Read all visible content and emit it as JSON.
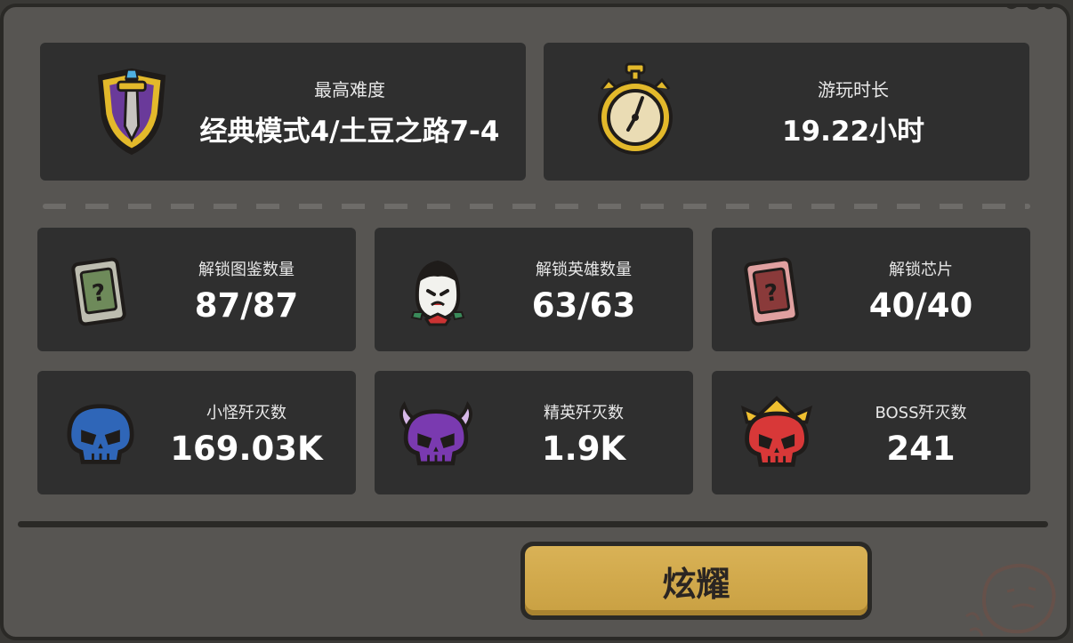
{
  "top_stats": [
    {
      "label": "最高难度",
      "value": "经典模式4/土豆之路7-4",
      "icon": "shield-sword-icon"
    },
    {
      "label": "游玩时长",
      "value": "19.22小时",
      "icon": "stopwatch-icon"
    }
  ],
  "grid_stats": [
    {
      "label": "解锁图鉴数量",
      "value": "87/87",
      "icon": "mystery-card-icon"
    },
    {
      "label": "解锁英雄数量",
      "value": "63/63",
      "icon": "hero-face-icon"
    },
    {
      "label": "解锁芯片",
      "value": "40/40",
      "icon": "red-chip-icon"
    },
    {
      "label": "小怪歼灭数",
      "value": "169.03K",
      "icon": "blue-skull-icon"
    },
    {
      "label": "精英歼灭数",
      "value": "1.9K",
      "icon": "purple-horned-skull-icon"
    },
    {
      "label": "BOSS歼灭数",
      "value": "241",
      "icon": "red-crowned-skull-icon"
    }
  ],
  "show_button": {
    "label": "炫耀"
  },
  "colors": {
    "panel": "#575552",
    "card": "#2f2f2f",
    "button": "#d3ab4f",
    "border": "#2a2926"
  }
}
